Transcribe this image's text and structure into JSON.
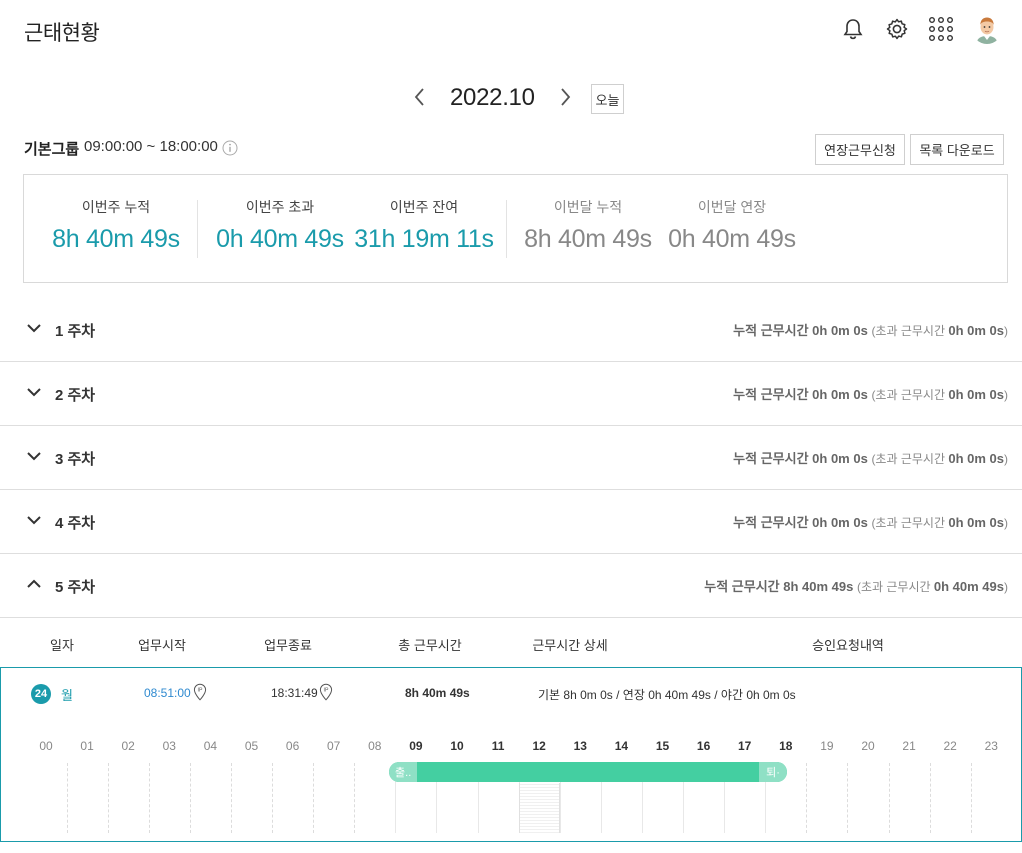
{
  "header": {
    "title": "근태현황",
    "icons": [
      "bell-icon",
      "gear-icon",
      "apps-grid-icon",
      "avatar"
    ]
  },
  "month_nav": {
    "month": "2022.10",
    "today_label": "오늘"
  },
  "group": {
    "name": "기본그룹",
    "hours": "09:00:00 ~ 18:00:00",
    "overtime_button": "연장근무신청",
    "download_button": "목록 다운로드"
  },
  "summary": {
    "stats": [
      {
        "label": "이번주 누적",
        "value": "8h 40m 49s"
      },
      {
        "label": "이번주 초과",
        "value": "0h 40m 49s"
      },
      {
        "label": "이번주 잔여",
        "value": "31h 19m 11s"
      },
      {
        "label": "이번달 누적",
        "value": "8h 40m 49s"
      },
      {
        "label": "이번달 연장",
        "value": "0h 40m 49s"
      }
    ]
  },
  "weeks": [
    {
      "label": "1 주차",
      "total_label": "누적 근무시간 ",
      "total": "0h 0m 0s",
      "over_label": "(초과 근무시간 ",
      "over": "0h 0m 0s",
      "close": ")"
    },
    {
      "label": "2 주차",
      "total_label": "누적 근무시간 ",
      "total": "0h 0m 0s",
      "over_label": "(초과 근무시간 ",
      "over": "0h 0m 0s",
      "close": ")"
    },
    {
      "label": "3 주차",
      "total_label": "누적 근무시간 ",
      "total": "0h 0m 0s",
      "over_label": "(초과 근무시간 ",
      "over": "0h 0m 0s",
      "close": ")"
    },
    {
      "label": "4 주차",
      "total_label": "누적 근무시간 ",
      "total": "0h 0m 0s",
      "over_label": "(초과 근무시간 ",
      "over": "0h 0m 0s",
      "close": ")"
    },
    {
      "label": "5 주차",
      "total_label": "누적 근무시간 ",
      "total": "8h 40m 49s",
      "over_label": "(초과 근무시간 ",
      "over": "0h 40m 49s",
      "close": ")"
    }
  ],
  "table": {
    "headers": [
      "일자",
      "업무시작",
      "업무종료",
      "총 근무시간",
      "근무시간 상세",
      "승인요청내역"
    ],
    "row": {
      "day": "24",
      "weekday": "월",
      "start": "08:51:00",
      "end": "18:31:49",
      "total": "8h 40m 49s",
      "detail": "기본 8h 0m 0s / 연장 0h 40m 49s / 야간 0h 0m 0s"
    }
  },
  "timeline": {
    "hours": [
      "00",
      "01",
      "02",
      "03",
      "04",
      "05",
      "06",
      "07",
      "08",
      "09",
      "10",
      "11",
      "12",
      "13",
      "14",
      "15",
      "16",
      "17",
      "18",
      "19",
      "20",
      "21",
      "22",
      "23"
    ],
    "work_start_hour": 8.85,
    "work_end_hour": 18.53,
    "lunch_start_hour": 12,
    "lunch_end_hour": 13,
    "start_cap": "출..",
    "end_cap": "퇴·",
    "bar_color": "#44cfa1",
    "accent_color": "#1a9bab"
  }
}
